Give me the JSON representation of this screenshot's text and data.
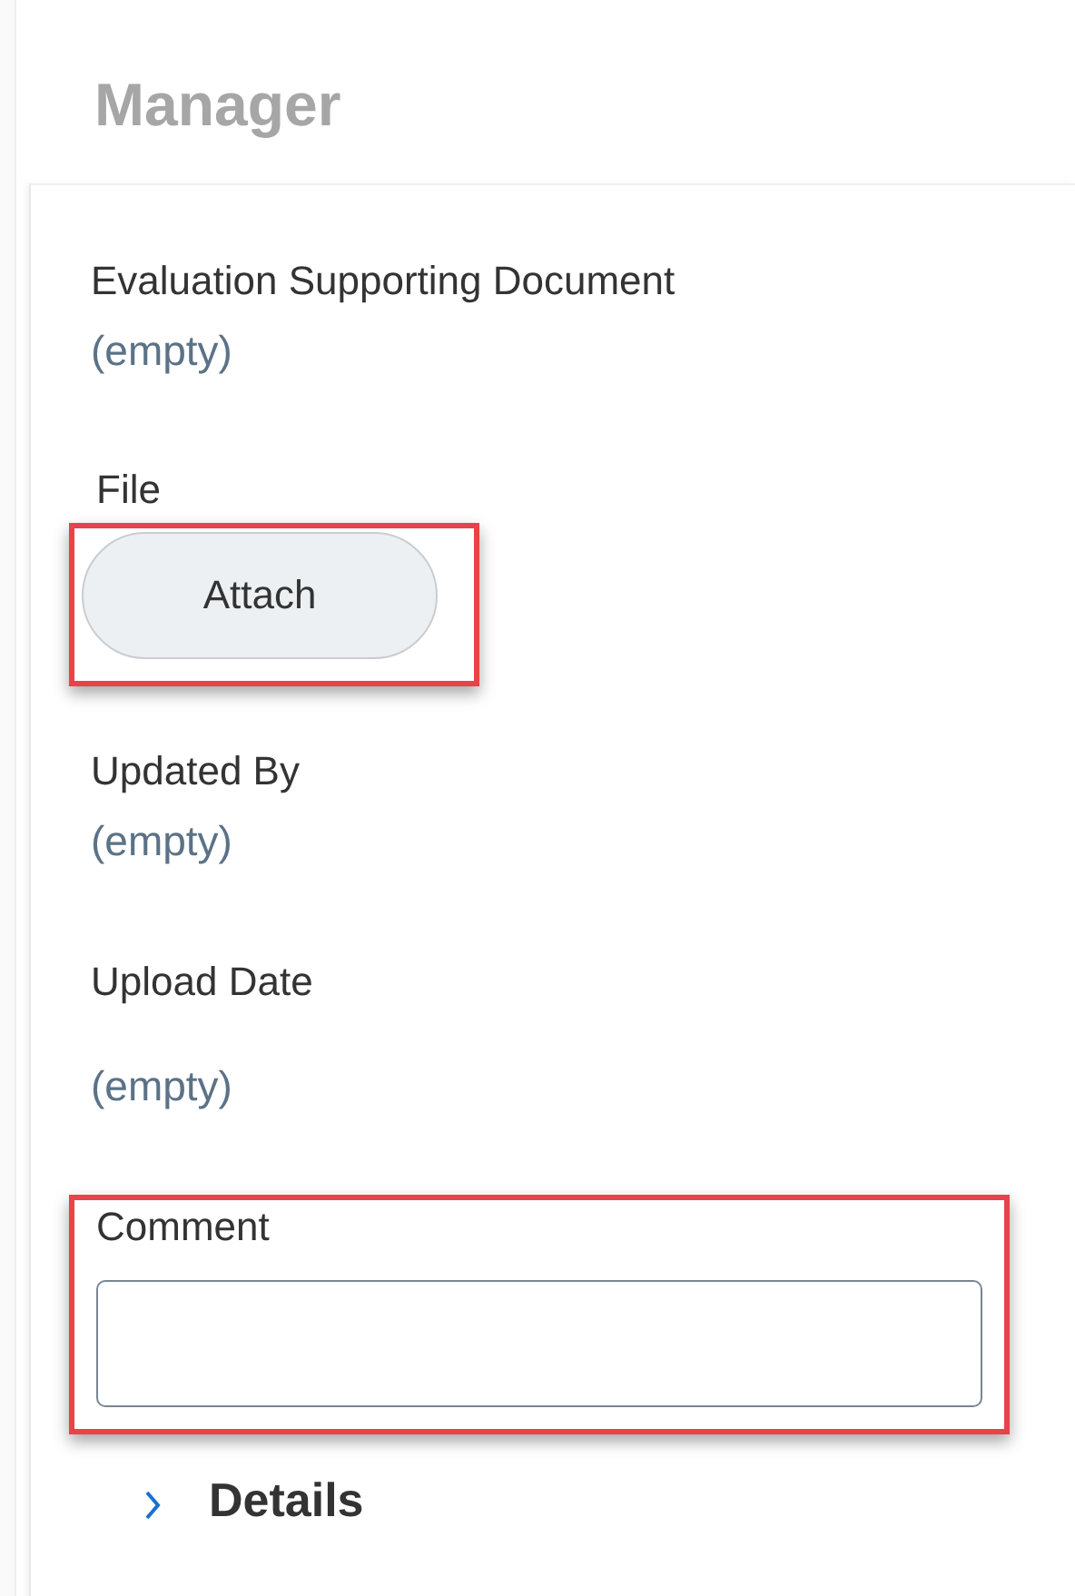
{
  "section_title": "Manager",
  "fields": [
    {
      "kind": "readonly",
      "label": "Evaluation Supporting Document",
      "value": "(empty)",
      "highlighted": false
    },
    {
      "kind": "attach",
      "label": "File",
      "button": "Attach",
      "highlighted": true
    },
    {
      "kind": "readonly",
      "label": "Updated By",
      "value": "(empty)",
      "highlighted": false
    },
    {
      "kind": "readonly_spaced",
      "label": "Upload Date",
      "value": "(empty)",
      "highlighted": false
    },
    {
      "kind": "text_input",
      "label": "Comment",
      "highlighted": true
    }
  ],
  "details": {
    "label": "Details",
    "expanded": false
  }
}
